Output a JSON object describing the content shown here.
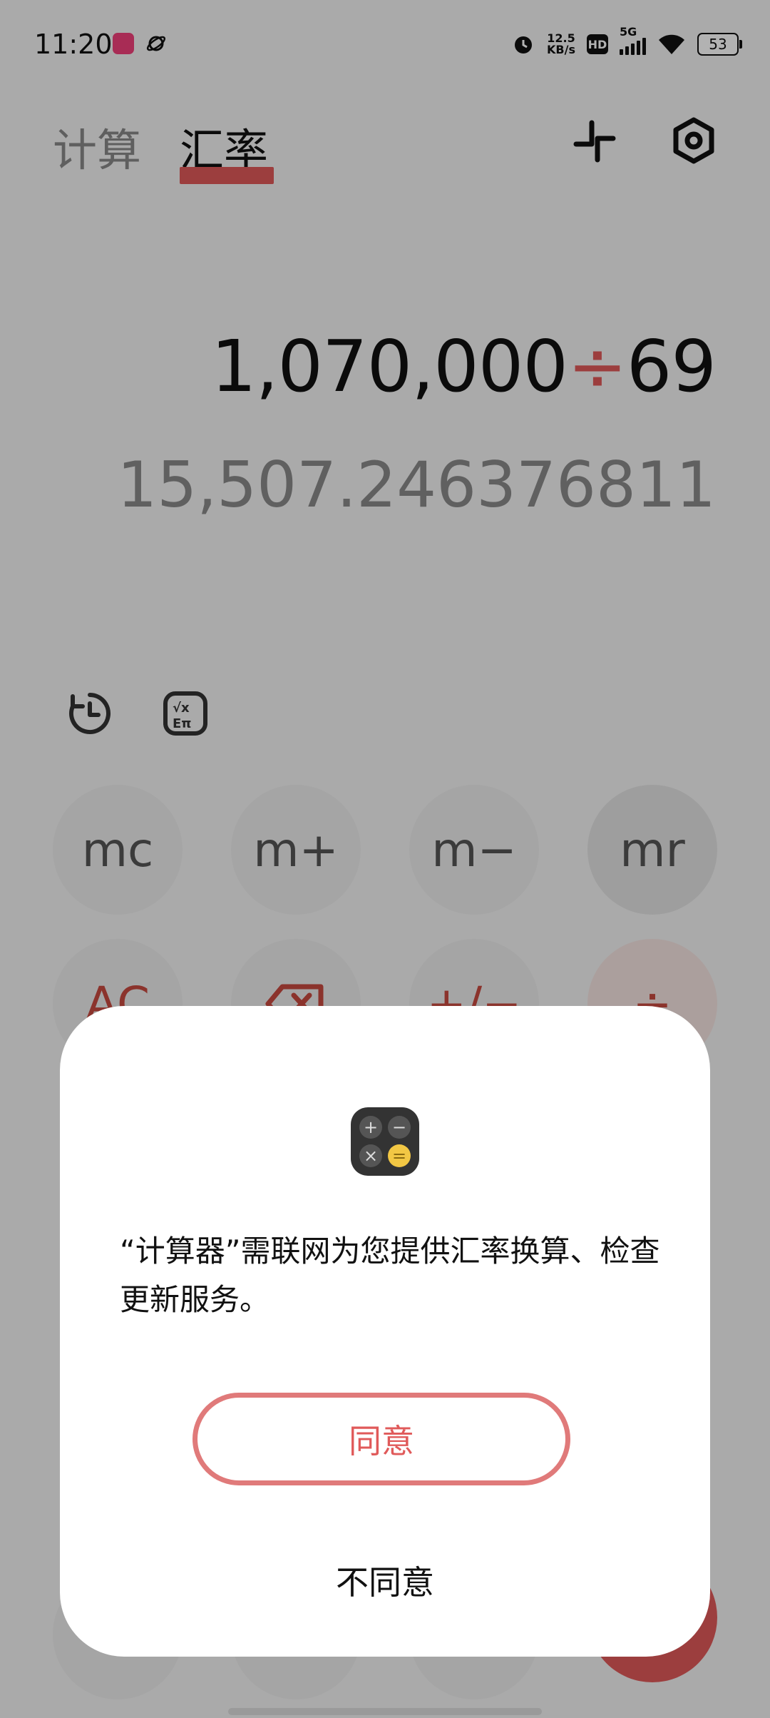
{
  "status_bar": {
    "time": "11:20",
    "net_speed_value": "12.5",
    "net_speed_unit": "KB/s",
    "hd": "HD",
    "network": "5G",
    "battery": "53"
  },
  "tabs": [
    {
      "label": "计算",
      "active": false
    },
    {
      "label": "汇率",
      "active": true
    }
  ],
  "top_icons": [
    "collapse-icon",
    "settings-icon"
  ],
  "display": {
    "expression_left": "1,070,000",
    "operator": "÷",
    "expression_right": "69",
    "result": "15,507.246376811"
  },
  "tools": [
    "history-icon",
    "scientific-icon"
  ],
  "keypad": {
    "row1": [
      "mc",
      "m+",
      "m−",
      "mr"
    ],
    "row2": [
      "AC",
      "backspace",
      "+/−",
      "÷"
    ]
  },
  "dialog": {
    "message": "“计算器”需联网为您提供汇率换算、检查更新服务。",
    "agree": "同意",
    "disagree": "不同意"
  },
  "colors": {
    "accent": "#e05a5a",
    "accent_light": "#f5e4e1",
    "text": "#111111",
    "muted": "#8a8a8a"
  }
}
